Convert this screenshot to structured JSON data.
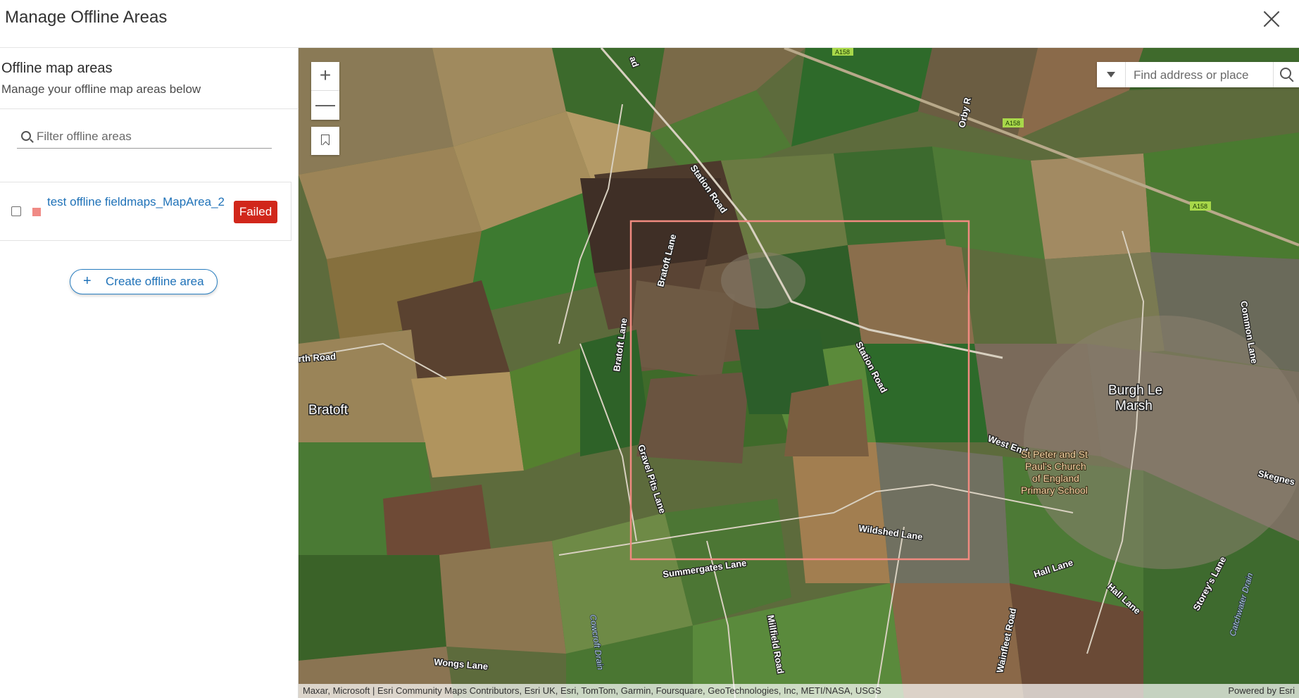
{
  "dialog": {
    "title": "Manage Offline Areas"
  },
  "panel": {
    "title": "Offline map areas",
    "subtitle": "Manage your offline map areas below",
    "filter_placeholder": "Filter offline areas"
  },
  "areas": [
    {
      "name": "test offline fieldmaps_MapArea_2",
      "status": "Failed",
      "swatch_color": "#f08a85"
    }
  ],
  "create_button": {
    "icon": "+",
    "label": "Create offline area"
  },
  "map": {
    "zoom_in": "+",
    "zoom_out": "—",
    "search_placeholder": "Find address or place",
    "attribution": "Maxar, Microsoft | Esri Community Maps Contributors, Esri UK, Esri, TomTom, Garmin, Foursquare, GeoTechnologies, Inc, METI/NASA, USGS",
    "powered_by": "Powered by Esri",
    "extent_color": "#f08a80",
    "labels": {
      "station_road_1": "Station Road",
      "station_road_2": "Station Road",
      "bratoft_lane_1": "Bratoft Lane",
      "bratoft_lane_2": "Bratoft Lane",
      "gravel_pits_lane": "Gravel Pits Lane",
      "summergates_lane": "Summergates Lane",
      "wildshed_lane": "Wildshed Lane",
      "west_end": "West End",
      "hall_lane_1": "Hall Lane",
      "hall_lane_2": "Hall Lane",
      "storeys_lane": "Storey's Lane",
      "common_lane": "Common Lane",
      "wainfleet_road": "Wainfleet Road",
      "millfield_road": "Millfield Road",
      "wongs_lane": "Wongs Lane",
      "north_road": "rth Road",
      "orby_road": "Orby R",
      "ad_fragment": "ad",
      "skegness": "Skegnes",
      "bratoft": "Bratoft",
      "burgh_line1": "Burgh Le",
      "burgh_line2": "Marsh",
      "school_line1": "St Peter and St",
      "school_line2": "Paul's Church",
      "school_line3": "of England",
      "school_line4": "Primary School",
      "cowcroft_drain": "Cowcroft Drain",
      "catchwater_drain": "Catchwater Drain",
      "a158_1": "A158",
      "a158_2": "A158",
      "a158_3": "A158"
    }
  }
}
